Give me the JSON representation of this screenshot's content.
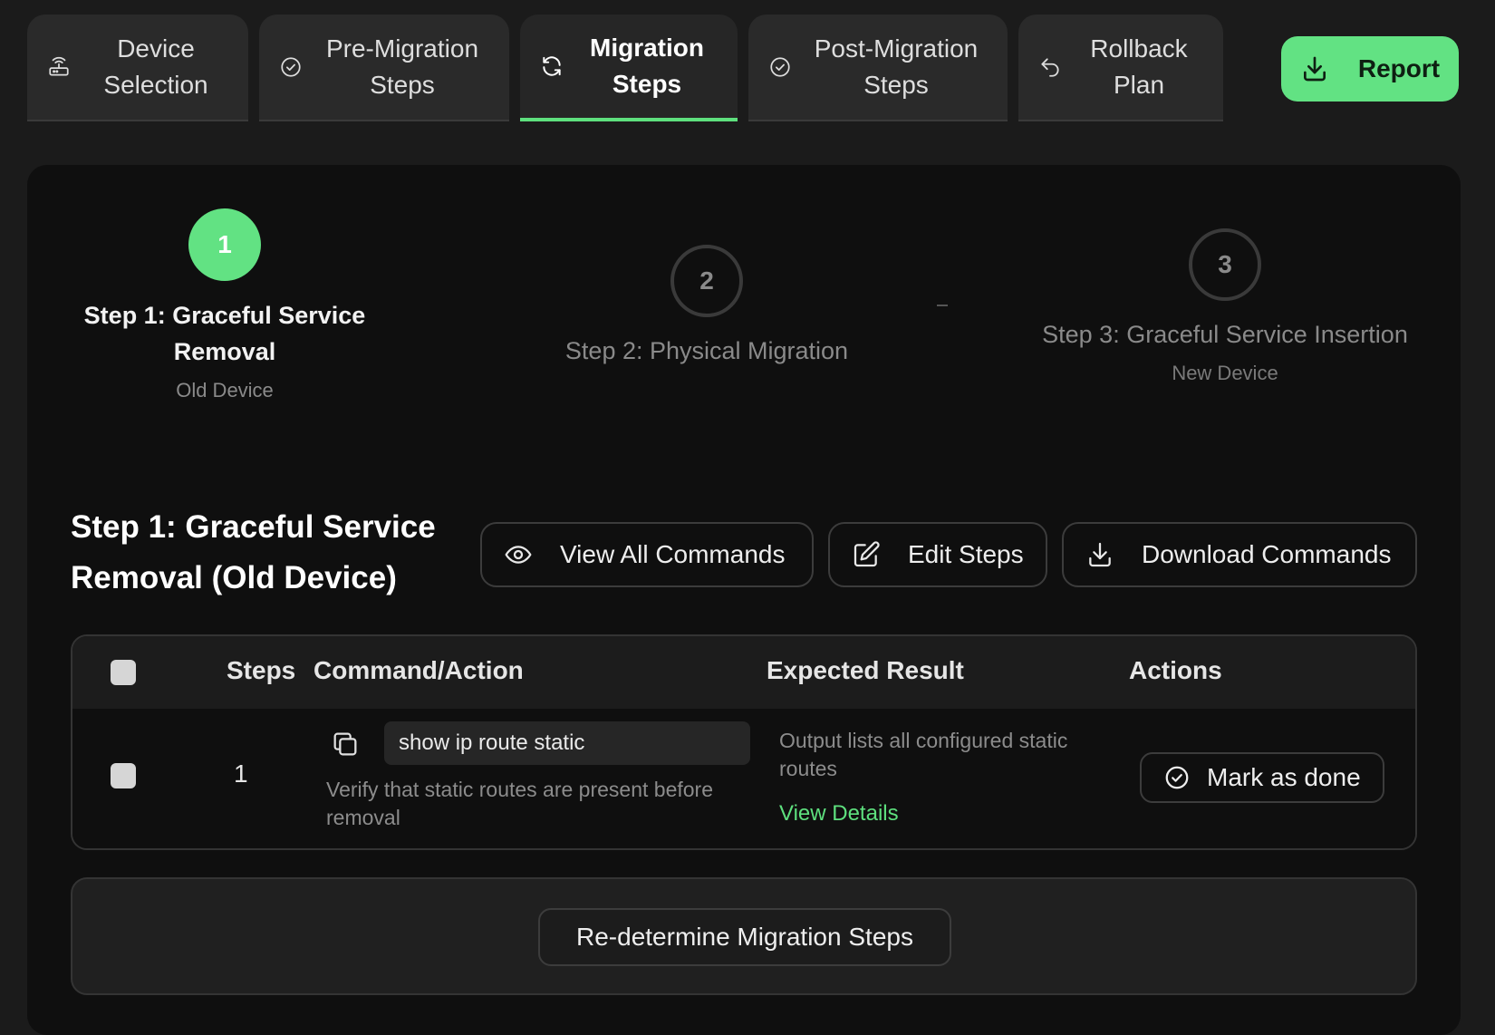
{
  "tabs": [
    {
      "label": "Device Selection",
      "icon": "router-icon",
      "active": false
    },
    {
      "label": "Pre-Migration Steps",
      "icon": "check-circle-icon",
      "active": false
    },
    {
      "label": "Migration Steps",
      "icon": "refresh-icon",
      "active": true
    },
    {
      "label": "Post-Migration Steps",
      "icon": "check-circle-icon",
      "active": false
    },
    {
      "label": "Rollback Plan",
      "icon": "undo-icon",
      "active": false
    }
  ],
  "report_button": {
    "label": "Report",
    "icon": "download-icon"
  },
  "stepper": [
    {
      "number": "1",
      "title": "Step 1: Graceful Service Removal",
      "subtitle": "Old Device",
      "status": "active"
    },
    {
      "number": "2",
      "title": "Step 2: Physical Migration",
      "subtitle": "",
      "status": "pending"
    },
    {
      "number": "3",
      "title": "Step 3: Graceful Service Insertion",
      "subtitle": "New Device",
      "status": "pending"
    }
  ],
  "section": {
    "title": "Step 1: Graceful Service Removal (Old Device)",
    "buttons": {
      "view_all": "View All Commands",
      "edit": "Edit Steps",
      "download": "Download Commands"
    }
  },
  "table": {
    "headers": {
      "steps": "Steps",
      "command": "Command/Action",
      "expected": "Expected Result",
      "actions": "Actions"
    },
    "rows": [
      {
        "step": "1",
        "command": "show ip route static",
        "description": "Verify that static routes are present before removal",
        "expected": "Output lists all configured static routes",
        "details_link": "View Details",
        "action_label": "Mark as done"
      }
    ]
  },
  "bottom": {
    "redetermine_label": "Re-determine Migration Steps"
  },
  "colors": {
    "accent": "#62e283",
    "background": "#1b1b1b",
    "panel": "#0f0f0f"
  }
}
